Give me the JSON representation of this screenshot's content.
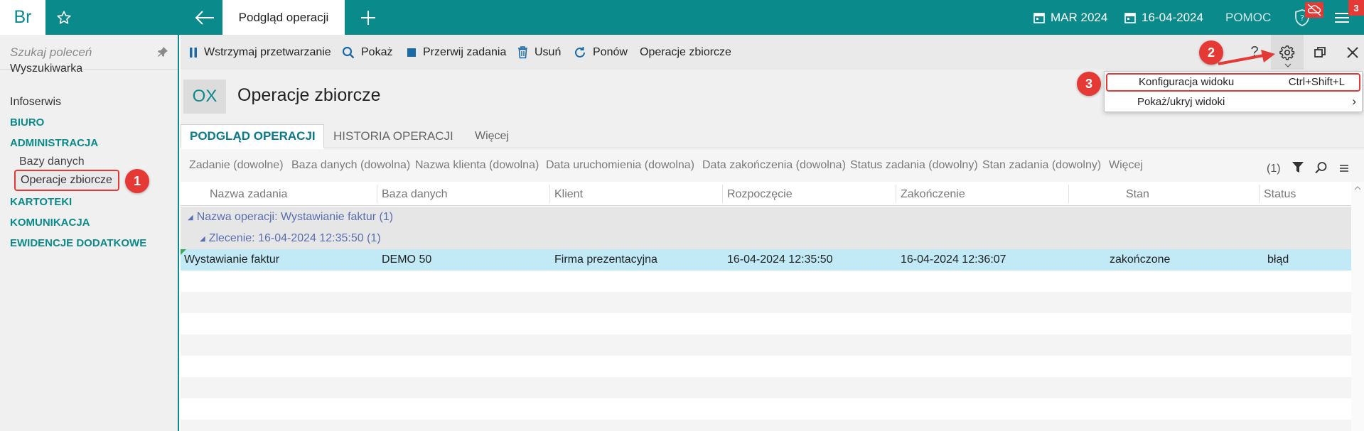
{
  "topbar": {
    "brand": "Br",
    "tab_title": "Podgląd operacji",
    "period": "MAR 2024",
    "date": "16-04-2024",
    "help": "POMOC",
    "notif_count": "3",
    "accent": "#0a8a8a"
  },
  "sidebar": {
    "search_placeholder": "Szukaj poleceń",
    "items": [
      {
        "label": "Wyszukiwarka"
      },
      {
        "label": "Infoserwis"
      },
      {
        "label": "BIURO"
      },
      {
        "label": "ADMINISTRACJA"
      },
      {
        "label": "Bazy danych"
      },
      {
        "label": "Operacje zbiorcze"
      },
      {
        "label": "KARTOTEKI"
      },
      {
        "label": "KOMUNIKACJA"
      },
      {
        "label": "EWIDENCJE DODATKOWE"
      }
    ]
  },
  "callouts": [
    "1",
    "2",
    "3"
  ],
  "toolbar": {
    "pause": "Wstrzymaj przetwarzanie",
    "show": "Pokaż",
    "stop": "Przerwij zadania",
    "delete": "Usuń",
    "retry": "Ponów",
    "bulk": "Operacje zbiorcze",
    "help_q": "?"
  },
  "page": {
    "icon_text": "OX",
    "title": "Operacje zbiorcze"
  },
  "tabs": [
    "PODGLĄD OPERACJI",
    "HISTORIA OPERACJI",
    "Więcej"
  ],
  "filters": {
    "items": [
      "Zadanie (dowolne)",
      "Baza danych (dowolna)",
      "Nazwa klienta (dowolna)",
      "Data uruchomienia (dowolna)",
      "Data zakończenia (dowolna)",
      "Status zadania (dowolny)",
      "Stan zadania (dowolny)",
      "Więcej"
    ],
    "count": "(1)"
  },
  "grid": {
    "columns": [
      "Nazwa zadania",
      "Baza danych",
      "Klient",
      "Rozpoczęcie",
      "Zakończenie",
      "Stan",
      "Status"
    ],
    "group1": "Nazwa operacji: Wystawianie faktur (1)",
    "group2": "Zlecenie: 16-04-2024 12:35:50 (1)",
    "row": [
      "Wystawianie faktur",
      "DEMO 50",
      "Firma prezentacyjna",
      "16-04-2024 12:35:50",
      "16-04-2024 12:36:07",
      "zakończone",
      "błąd"
    ]
  },
  "menu": {
    "item1_label": "Konfiguracja widoku",
    "item1_shortcut": "Ctrl+Shift+L",
    "item2_label": "Pokaż/ukryj widoki",
    "item2_arrow": "›"
  }
}
